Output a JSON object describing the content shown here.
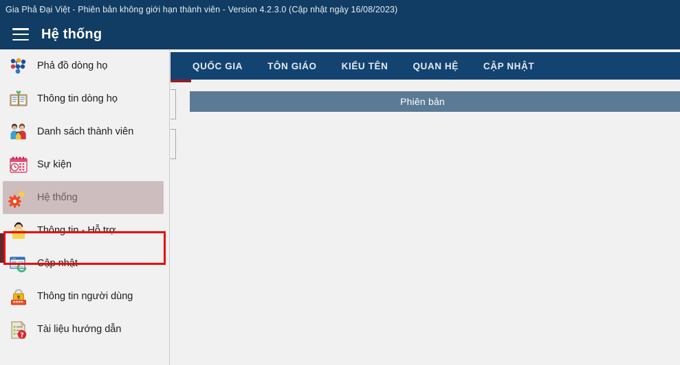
{
  "window": {
    "title": "Gia Phả Đại Việt - Phiên bản không giới hạn thành viên - Version 4.2.3.0 (Cập nhật ngày 16/08/2023)"
  },
  "header": {
    "menu_icon": "hamburger-icon",
    "title": "Hệ thống"
  },
  "sidebar": {
    "items": [
      {
        "label": "Phả đồ dòng họ",
        "icon": "family-tree-icon",
        "selected": false
      },
      {
        "label": "Thông tin dòng họ",
        "icon": "open-book-icon",
        "selected": false
      },
      {
        "label": "Danh sách thành viên",
        "icon": "family-people-icon",
        "selected": false
      },
      {
        "label": "Sự kiện",
        "icon": "calendar-clock-icon",
        "selected": false
      },
      {
        "label": "Hệ thống",
        "icon": "gear-sparkle-icon",
        "selected": true
      },
      {
        "label": "Thông tin - Hỗ trợ",
        "icon": "support-person-icon",
        "selected": false
      },
      {
        "label": "Cập nhật",
        "icon": "window-refresh-icon",
        "selected": false
      },
      {
        "label": "Thông tin người dùng",
        "icon": "padlock-password-icon",
        "selected": false
      },
      {
        "label": "Tài liệu hướng dẫn",
        "icon": "document-help-icon",
        "selected": false
      }
    ]
  },
  "main": {
    "tabs": [
      {
        "label": "QUỐC GIA"
      },
      {
        "label": "TÔN GIÁO"
      },
      {
        "label": "KIỂU TÊN"
      },
      {
        "label": "QUAN HỆ"
      },
      {
        "label": "CẬP NHẬT"
      }
    ],
    "banner": {
      "label": "Phiên bản"
    }
  },
  "colors": {
    "titlebar": "#113c63",
    "tabbar": "#134371",
    "tab_underline": "#8e2026",
    "banner": "#5b7a95",
    "selection_outline": "#ef0000",
    "selection_fill": "#cdbdbf",
    "selection_leftbar": "#5c2a32",
    "page_background": "#f1f1f1"
  }
}
